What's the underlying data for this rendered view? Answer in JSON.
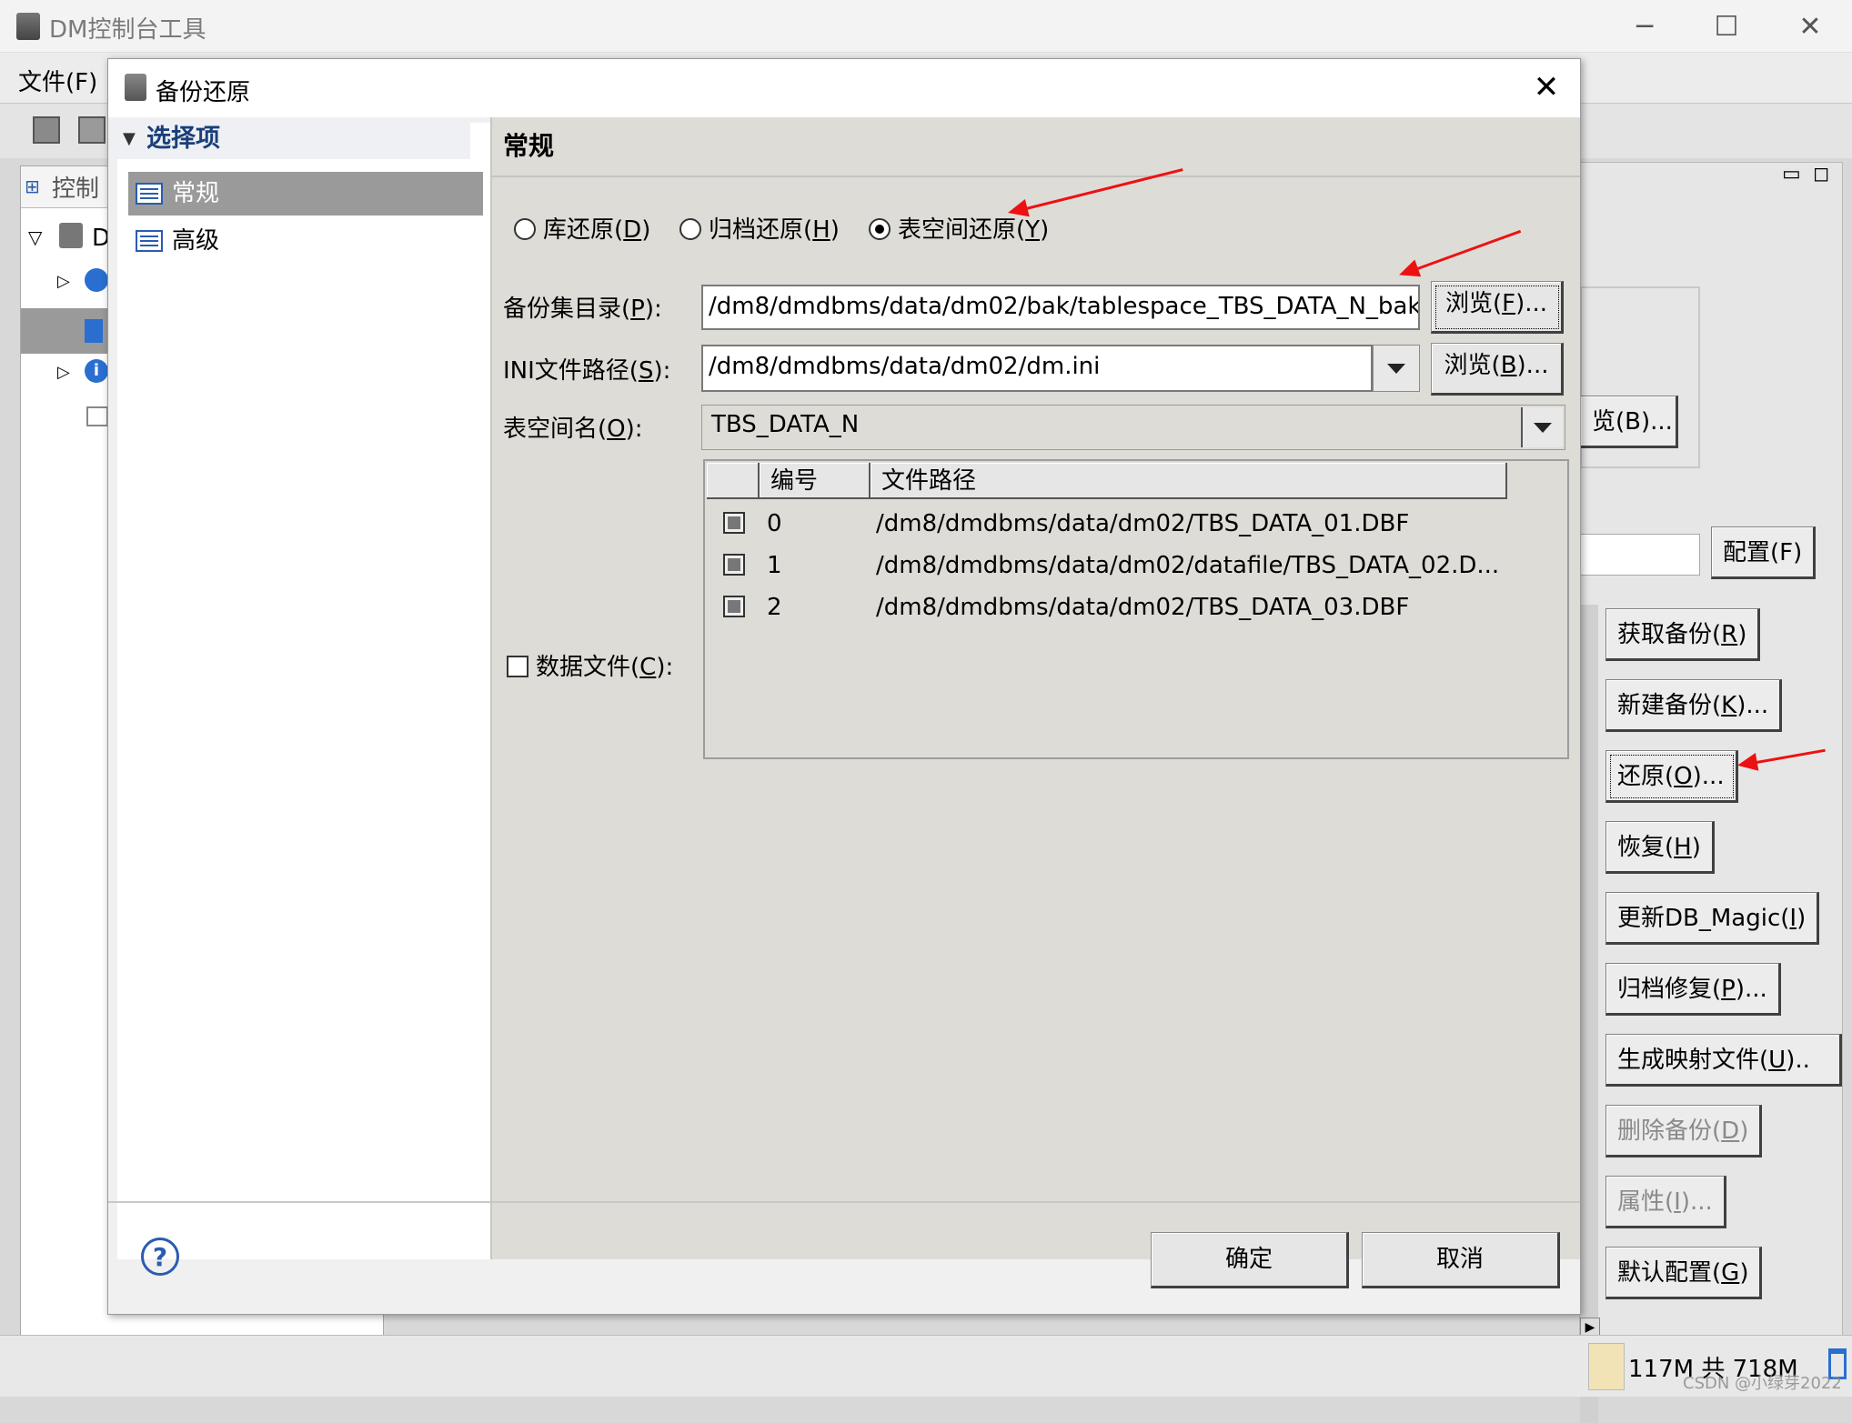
{
  "window": {
    "title": "DM控制台工具",
    "menu_file": "文件(F)",
    "left_tab": "控制",
    "tree_node": "D"
  },
  "dialog": {
    "title": "备份还原",
    "nav": {
      "header": "选择项",
      "items": [
        {
          "label": "常规",
          "selected": true
        },
        {
          "label": "高级",
          "selected": false
        }
      ]
    },
    "section_title": "常规",
    "radios": [
      {
        "label": "库还原",
        "key": "D",
        "checked": false
      },
      {
        "label": "归档还原",
        "key": "H",
        "checked": false
      },
      {
        "label": "表空间还原",
        "key": "Y",
        "checked": true
      }
    ],
    "backup_dir": {
      "label": "备份集目录",
      "key": "P",
      "value": "/dm8/dmdbms/data/dm02/bak/tablespace_TBS_DATA_N_bak",
      "browse_label": "浏览",
      "browse_key": "F"
    },
    "ini_path": {
      "label": "INI文件路径",
      "key": "S",
      "value": "/dm8/dmdbms/data/dm02/dm.ini",
      "browse_label": "浏览",
      "browse_key": "B"
    },
    "tablespace": {
      "label": "表空间名",
      "key": "O",
      "value": "TBS_DATA_N"
    },
    "datafile_checkbox": {
      "label": "数据文件",
      "key": "C",
      "checked": false
    },
    "files_table": {
      "columns": [
        "编号",
        "文件路径"
      ],
      "rows": [
        {
          "no": "0",
          "path": "/dm8/dmdbms/data/dm02/TBS_DATA_01.DBF",
          "checked": true
        },
        {
          "no": "1",
          "path": "/dm8/dmdbms/data/dm02/datafile/TBS_DATA_02.D...",
          "checked": true
        },
        {
          "no": "2",
          "path": "/dm8/dmdbms/data/dm02/TBS_DATA_03.DBF",
          "checked": true
        }
      ]
    },
    "ok_label": "确定",
    "cancel_label": "取消"
  },
  "right_panel": {
    "browse_partial": "览(B)...",
    "config_label": "配置(F)",
    "buttons": [
      {
        "label": "获取备份",
        "key": "R",
        "suffix": "",
        "enabled": true
      },
      {
        "label": "新建备份",
        "key": "K",
        "suffix": "...",
        "enabled": true
      },
      {
        "label": "还原",
        "key": "O",
        "suffix": "...",
        "enabled": true
      },
      {
        "label": "恢复",
        "key": "H",
        "suffix": "",
        "enabled": true
      },
      {
        "label": "更新DB_Magic",
        "key": "I",
        "suffix": "",
        "enabled": true
      },
      {
        "label": "归档修复",
        "key": "P",
        "suffix": "...",
        "enabled": true
      },
      {
        "label": "生成映射文件",
        "key": "U",
        "suffix": "..",
        "enabled": true
      },
      {
        "label": "删除备份",
        "key": "D",
        "suffix": "",
        "enabled": false
      },
      {
        "label": "属性",
        "key": "I",
        "suffix": "...",
        "enabled": false
      },
      {
        "label": "默认配置",
        "key": "G",
        "suffix": "",
        "enabled": true
      }
    ]
  },
  "status": {
    "memory": "117M 共 718M",
    "watermark": "CSDN @小绿芽2022"
  },
  "colors": {
    "arrow": "#ee1111",
    "selection": "#9a9a9a",
    "nav_header": "#1a3e7a"
  }
}
